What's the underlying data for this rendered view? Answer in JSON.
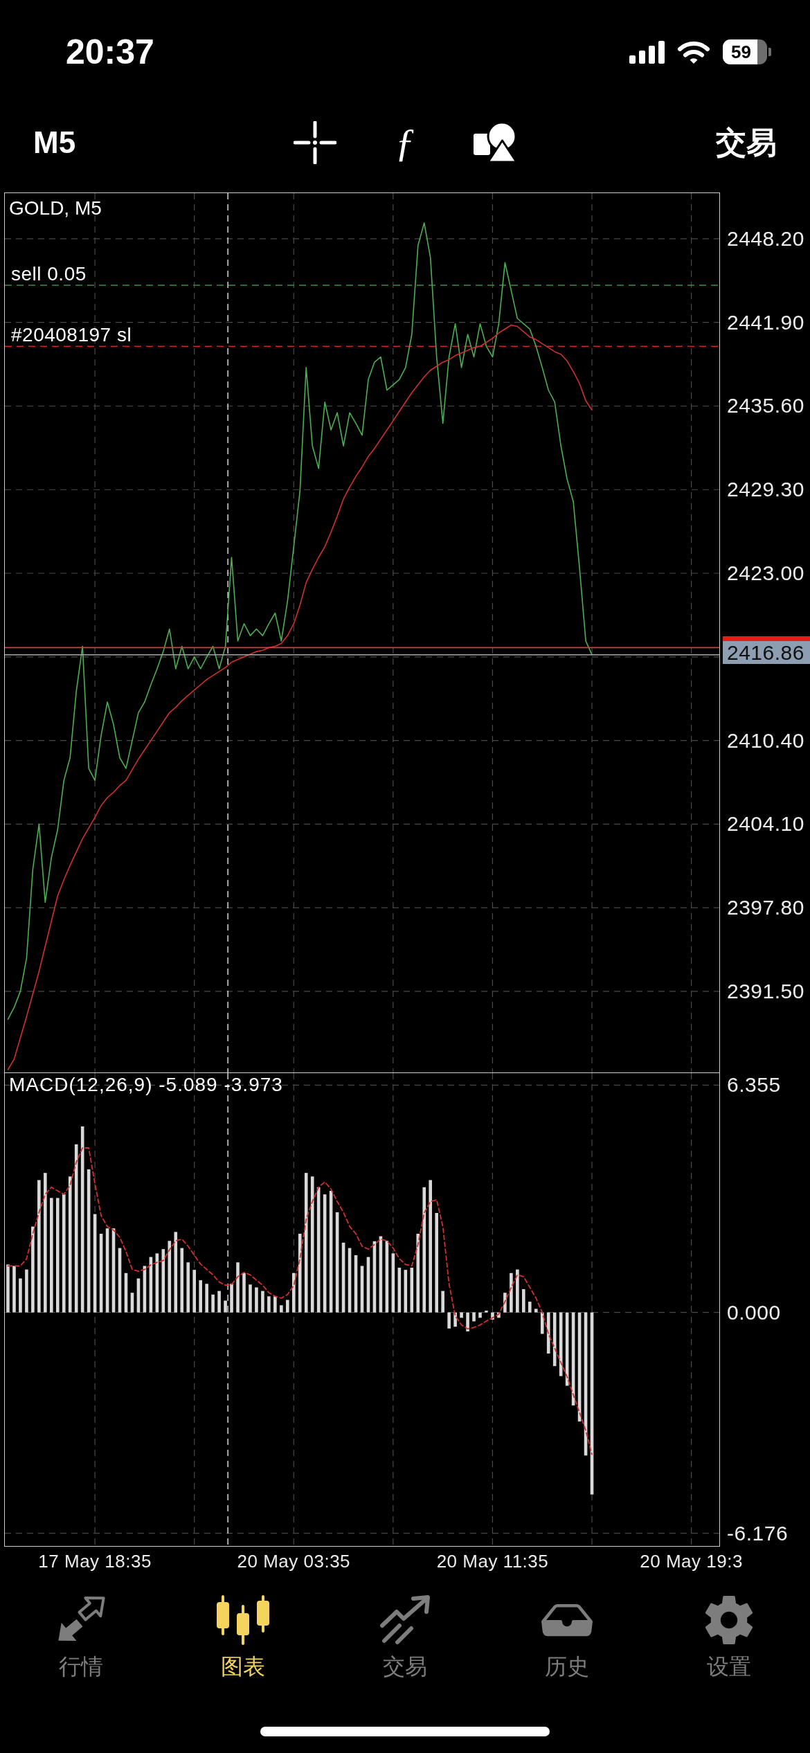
{
  "status_bar": {
    "time": "20:37",
    "battery": "59"
  },
  "toolbar": {
    "timeframe": "M5",
    "function_button": "ƒ",
    "trade_button": "交易"
  },
  "price_chart": {
    "current_price": "2416.86",
    "chart_data": {
      "type": "line",
      "title": "GOLD, M5",
      "grid": true,
      "ylim": [
        2385.39,
        2451.64
      ],
      "yticks": [
        {
          "value": 2448.2,
          "label": "2448.20"
        },
        {
          "value": 2441.9,
          "label": "2441.90"
        },
        {
          "value": 2435.6,
          "label": "2435.60"
        },
        {
          "value": 2429.3,
          "label": "2429.30"
        },
        {
          "value": 2423,
          "label": "2423.00"
        },
        {
          "value": 2410.4,
          "label": "2410.40"
        },
        {
          "value": 2404.1,
          "label": "2404.10"
        },
        {
          "value": 2397.8,
          "label": "2397.80"
        },
        {
          "value": 2391.5,
          "label": "2391.50"
        }
      ],
      "series": [
        {
          "color": "#4caf50",
          "values": [
            2389.4,
            2390.3,
            2391.5,
            2394.0,
            2400.7,
            2404.1,
            2398.2,
            2401.6,
            2403.7,
            2407.4,
            2409.1,
            2414.1,
            2417.5,
            2408.3,
            2407.4,
            2410.8,
            2413.3,
            2411.6,
            2409.1,
            2408.3,
            2410.4,
            2412.5,
            2413.3,
            2414.6,
            2415.8,
            2417.1,
            2418.8,
            2415.8,
            2417.5,
            2415.8,
            2416.7,
            2415.8,
            2416.7,
            2417.5,
            2415.8,
            2417.5,
            2424.2,
            2417.9,
            2419.2,
            2418.3,
            2418.8,
            2418.3,
            2419.2,
            2420.0,
            2417.9,
            2420.9,
            2425.0,
            2429.2,
            2438.5,
            2432.6,
            2430.9,
            2435.9,
            2433.8,
            2435.1,
            2432.6,
            2435.1,
            2434.3,
            2433.4,
            2437.6,
            2438.9,
            2439.3,
            2436.8,
            2437.2,
            2437.6,
            2438.5,
            2441.0,
            2447.7,
            2449.4,
            2446.8,
            2439.3,
            2434.3,
            2439.3,
            2441.8,
            2438.5,
            2441.0,
            2439.3,
            2441.8,
            2440.1,
            2439.3,
            2441.8,
            2446.4,
            2444.3,
            2442.2,
            2441.8,
            2441.4,
            2440.1,
            2438.5,
            2436.8,
            2435.9,
            2432.6,
            2430.1,
            2428.4,
            2423.4,
            2417.9,
            2416.86
          ]
        },
        {
          "color": "#d32f2f",
          "values": [
            2385.6,
            2386.4,
            2388.0,
            2389.6,
            2391.3,
            2393.0,
            2394.9,
            2396.8,
            2398.7,
            2399.9,
            2401.0,
            2402.0,
            2403.0,
            2403.8,
            2404.6,
            2405.5,
            2406.1,
            2406.5,
            2407.0,
            2407.4,
            2408.2,
            2409.0,
            2409.7,
            2410.4,
            2411.1,
            2411.8,
            2412.5,
            2412.9,
            2413.4,
            2413.8,
            2414.2,
            2414.6,
            2415.0,
            2415.3,
            2415.6,
            2415.9,
            2416.3,
            2416.5,
            2416.7,
            2416.9,
            2417.1,
            2417.2,
            2417.4,
            2417.5,
            2417.7,
            2418.3,
            2419.2,
            2420.6,
            2422.3,
            2423.3,
            2424.2,
            2425.0,
            2426.1,
            2427.3,
            2428.6,
            2429.5,
            2430.3,
            2431.0,
            2431.8,
            2432.4,
            2433.1,
            2433.8,
            2434.5,
            2435.2,
            2435.9,
            2436.6,
            2437.2,
            2437.8,
            2438.3,
            2438.6,
            2438.9,
            2439.1,
            2439.4,
            2439.6,
            2439.8,
            2440.0,
            2440.1,
            2440.4,
            2440.7,
            2441.1,
            2441.4,
            2441.7,
            2441.6,
            2441.2,
            2440.8,
            2440.6,
            2440.3,
            2440.0,
            2439.7,
            2439.5,
            2439.0,
            2438.2,
            2437.3,
            2436.0,
            2435.3
          ]
        }
      ],
      "ref_lines": [
        {
          "axis": "y",
          "value": 2444.7,
          "label": "sell 0.05",
          "color": "#3e8e41"
        },
        {
          "axis": "y",
          "value": 2440.1,
          "label": "#20408197 sl",
          "color": "#c62828"
        },
        {
          "axis": "y",
          "value": 2417.4,
          "color": "#e53935"
        },
        {
          "axis": "y",
          "value": 2416.86,
          "color": "#a8a8a8"
        }
      ]
    }
  },
  "macd_chart": {
    "chart_data": {
      "type": "bar",
      "title": "MACD(12,26,9) -5.089 -3.973",
      "grid": true,
      "ylim": [
        -6.53,
        6.69
      ],
      "categories": [
        null,
        null,
        null,
        null,
        null,
        null,
        null,
        null,
        null,
        null,
        null,
        null,
        null,
        null,
        "17 May 18:35",
        null,
        null,
        null,
        null,
        null,
        null,
        null,
        null,
        null,
        null,
        null,
        null,
        null,
        null,
        null,
        null,
        null,
        null,
        null,
        null,
        null,
        null,
        null,
        null,
        null,
        null,
        null,
        null,
        null,
        null,
        null,
        "20 May 03:35",
        null,
        null,
        null,
        null,
        null,
        null,
        null,
        null,
        null,
        null,
        null,
        null,
        null,
        null,
        null,
        null,
        null,
        null,
        null,
        null,
        null,
        null,
        null,
        null,
        null,
        null,
        null,
        null,
        null,
        null,
        null,
        "20 May 11:35",
        null,
        null,
        null,
        null,
        null,
        null,
        null,
        null,
        null,
        null,
        null,
        null,
        null,
        null,
        null,
        null,
        null,
        null,
        null,
        null,
        null,
        null,
        null,
        null,
        null,
        null,
        null,
        null,
        null,
        null,
        null,
        "20 May 19:3",
        null,
        null,
        null,
        null
      ],
      "yticks": [
        {
          "value": 6.355,
          "label": "6.355"
        },
        {
          "value": 0,
          "label": "0.000"
        },
        {
          "value": -6.176,
          "label": "-6.176"
        }
      ],
      "series": [
        {
          "color": "#d9d9d9",
          "values": [
            1.34,
            1.3,
            0.95,
            1.2,
            2.4,
            3.7,
            3.9,
            3.2,
            3.2,
            3.3,
            3.8,
            4.7,
            5.2,
            4.0,
            2.75,
            2.2,
            2.35,
            2.35,
            1.8,
            1.1,
            0.55,
            0.95,
            1.3,
            1.55,
            1.65,
            1.77,
            2.0,
            2.25,
            1.8,
            1.4,
            1.19,
            0.9,
            0.8,
            0.5,
            0.6,
            0.33,
            0.8,
            1.4,
            1.1,
            0.78,
            0.7,
            0.6,
            0.45,
            0.45,
            0.2,
            0.35,
            1.1,
            2.2,
            3.9,
            3.8,
            3.5,
            3.3,
            3.4,
            2.8,
            1.95,
            1.8,
            1.6,
            1.3,
            1.55,
            1.99,
            2.13,
            2.0,
            1.65,
            1.25,
            1.19,
            1.25,
            2.2,
            3.5,
            3.7,
            2.78,
            0.6,
            -0.45,
            -0.4,
            -0.15,
            -0.53,
            -0.25,
            -0.15,
            0.05,
            -0.2,
            -0.15,
            0.55,
            1.1,
            1.2,
            0.65,
            0.3,
            0.1,
            -0.6,
            -1.15,
            -1.5,
            -1.78,
            -2.05,
            -2.6,
            -3.05,
            -4.0,
            -5.09,
            null,
            null,
            null,
            null,
            null,
            null,
            null,
            null,
            null,
            null,
            null,
            null,
            null,
            null,
            null,
            null,
            null,
            null,
            null,
            null
          ]
        },
        {
          "type": "line",
          "line_style": "dashed",
          "color": "#d32f2f",
          "values": [
            1.3,
            1.3,
            1.3,
            1.5,
            2.2,
            2.8,
            3.3,
            3.5,
            3.4,
            3.3,
            3.55,
            4.2,
            4.6,
            4.6,
            3.6,
            2.7,
            2.4,
            2.3,
            2.1,
            1.7,
            1.2,
            1.15,
            1.2,
            1.33,
            1.4,
            1.45,
            1.75,
            2.0,
            2.05,
            1.85,
            1.6,
            1.35,
            1.2,
            1.05,
            0.85,
            0.76,
            0.78,
            1.0,
            1.12,
            1.05,
            0.9,
            0.76,
            0.55,
            0.45,
            0.4,
            0.5,
            0.75,
            1.5,
            2.6,
            3.1,
            3.5,
            3.65,
            3.45,
            3.1,
            2.8,
            2.4,
            2.2,
            1.85,
            1.77,
            1.9,
            2.05,
            2.0,
            1.8,
            1.5,
            1.34,
            1.3,
            1.9,
            2.78,
            3.1,
            3.15,
            2.4,
            0.8,
            -0.1,
            -0.35,
            -0.46,
            -0.42,
            -0.35,
            -0.24,
            -0.15,
            -0.05,
            0.3,
            0.7,
            1.05,
            1.0,
            0.7,
            0.4,
            0.0,
            -0.6,
            -1.0,
            -1.4,
            -1.8,
            -2.3,
            -2.8,
            -3.3,
            -3.97,
            null,
            null,
            null,
            null,
            null,
            null,
            null,
            null,
            null,
            null,
            null,
            null,
            null,
            null,
            null,
            null,
            null,
            null,
            null,
            null
          ]
        }
      ]
    }
  },
  "tab_bar": [
    {
      "label": "行情",
      "selected": false
    },
    {
      "label": "图表",
      "selected": true
    },
    {
      "label": "交易",
      "selected": false
    },
    {
      "label": "历史",
      "selected": false
    },
    {
      "label": "设置",
      "selected": false
    }
  ]
}
